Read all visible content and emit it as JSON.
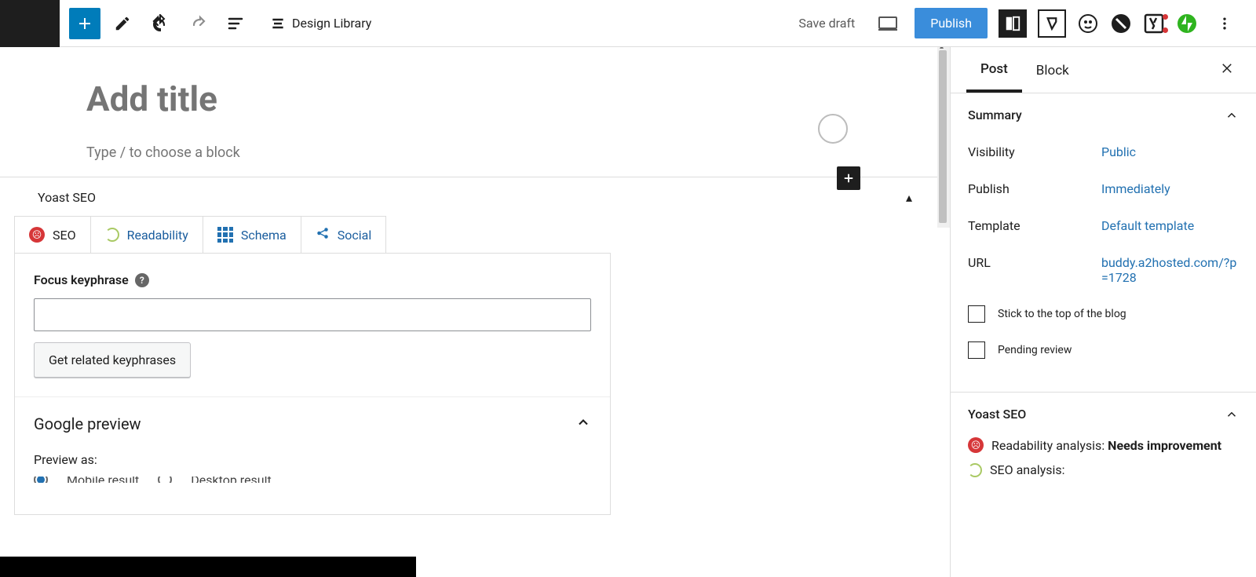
{
  "toolbar": {
    "design_library": "Design Library",
    "save_draft": "Save draft",
    "publish": "Publish"
  },
  "editor": {
    "title_placeholder": "Add title",
    "block_hint": "Type / to choose a block"
  },
  "yoast": {
    "panel_title": "Yoast SEO",
    "tabs": {
      "seo": "SEO",
      "readability": "Readability",
      "schema": "Schema",
      "social": "Social"
    },
    "focus_label": "Focus keyphrase",
    "related_btn": "Get related keyphrases",
    "google_preview": "Google preview",
    "preview_as": "Preview as:",
    "mobile": "Mobile result",
    "desktop": "Desktop result"
  },
  "sidebar": {
    "tab_post": "Post",
    "tab_block": "Block",
    "summary": "Summary",
    "visibility_label": "Visibility",
    "visibility_value": "Public",
    "publish_label": "Publish",
    "publish_value": "Immediately",
    "template_label": "Template",
    "template_value": "Default template",
    "url_label": "URL",
    "url_value": "buddy.a2hosted.com/?p=1728",
    "stick_label": "Stick to the top of the blog",
    "pending_label": "Pending review",
    "yoast_heading": "Yoast SEO",
    "readability_label": "Readability analysis: ",
    "readability_status": "Needs improvement",
    "seo_analysis_label": "SEO analysis:"
  }
}
